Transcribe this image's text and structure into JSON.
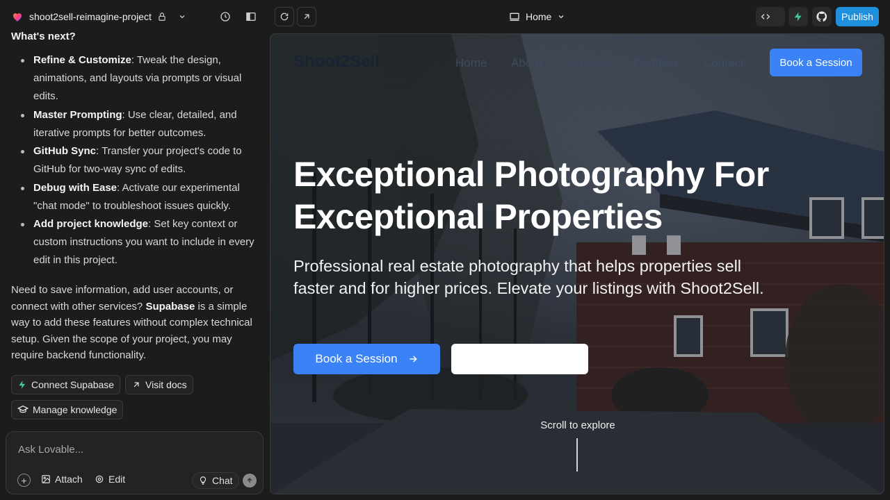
{
  "topbar": {
    "project_name": "shoot2sell-reimagine-project",
    "page_selector": "Home",
    "publish_label": "Publish"
  },
  "chat": {
    "heading": "What's next?",
    "bullets": [
      {
        "title": "Refine & Customize",
        "text": ": Tweak the design, animations, and layouts via prompts or visual edits."
      },
      {
        "title": "Master Prompting",
        "text": ": Use clear, detailed, and iterative prompts for better outcomes."
      },
      {
        "title": "GitHub Sync",
        "text": ": Transfer your project's code to GitHub for two-way sync of edits."
      },
      {
        "title": "Debug with Ease",
        "text": ": Activate our experimental \"chat mode\" to troubleshoot issues quickly."
      },
      {
        "title": "Add project knowledge",
        "text": ": Set key context or custom instructions you want to include in every edit in this project."
      }
    ],
    "para_before": "Need to save information, add user accounts, or connect with other services? ",
    "para_bold": "Supabase",
    "para_after": " is a simple way to add these features without complex technical setup. Given the scope of your project, you may require backend functionality.",
    "chips": {
      "connect": "Connect Supabase",
      "docs": "Visit docs",
      "knowledge": "Manage knowledge"
    },
    "input": {
      "placeholder": "Ask Lovable...",
      "attach": "Attach",
      "edit": "Edit",
      "chat": "Chat"
    }
  },
  "preview": {
    "brand": "Shoot2Sell",
    "nav": [
      "Home",
      "About",
      "Services",
      "Portfolio",
      "Contact"
    ],
    "nav_cta": "Book a Session",
    "hero_title": "Exceptional Photography For Exceptional Properties",
    "hero_subtitle": "Professional real estate photography that helps properties sell faster and for higher prices. Elevate your listings with Shoot2Sell.",
    "cta_primary": "Book a Session",
    "scroll_hint": "Scroll to explore"
  },
  "colors": {
    "accent_blue": "#3b82f6",
    "publish_blue": "#1f8fdc",
    "bolt_green": "#3ecf8e"
  }
}
